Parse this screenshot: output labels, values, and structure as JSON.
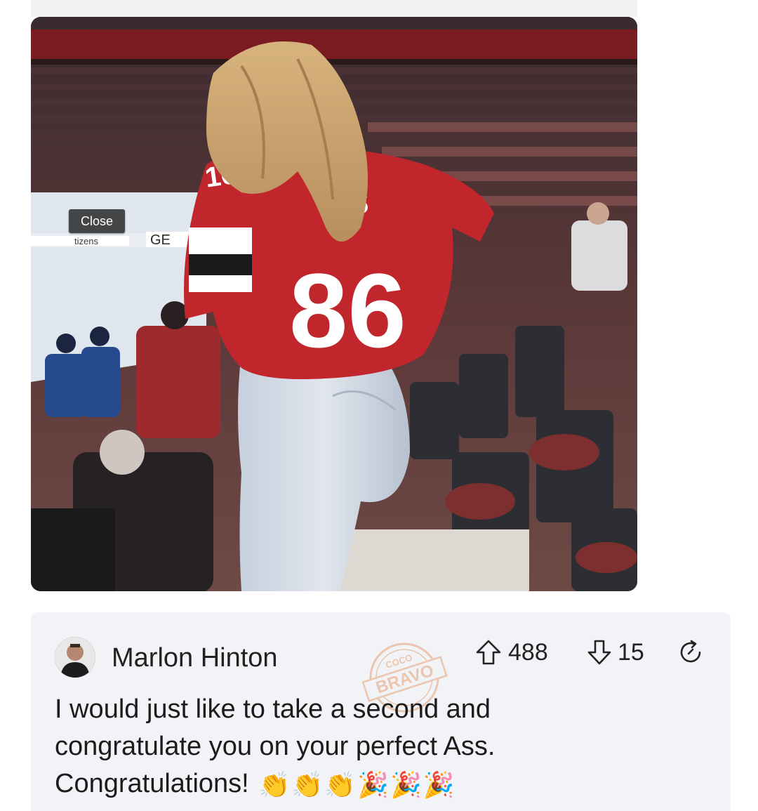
{
  "photo": {
    "close_label": "Close",
    "arena_boards_text": "tizens",
    "arena_boards_text2": "GE",
    "jersey_letters": "IS",
    "jersey_number": "86",
    "jersey_shoulder_number": "16"
  },
  "comment": {
    "author": "Marlon Hinton",
    "upvotes": "488",
    "downvotes": "15",
    "text_line1": "I would just like to take a second and",
    "text_line2": "congratulate you on your perfect Ass.",
    "text_line3": "Congratulations!",
    "emojis": "👏👏👏🎉🎉🎉"
  },
  "watermark": {
    "top": "COCO",
    "main": "BRAVO"
  },
  "icons": {
    "upvote": "arrow-up-icon",
    "downvote": "arrow-down-icon",
    "share": "share-icon"
  },
  "colors": {
    "card_bg": "#f2f3f6",
    "text": "#1c1c1c",
    "jersey_red": "#c0262c",
    "stamp": "#e2884a"
  }
}
